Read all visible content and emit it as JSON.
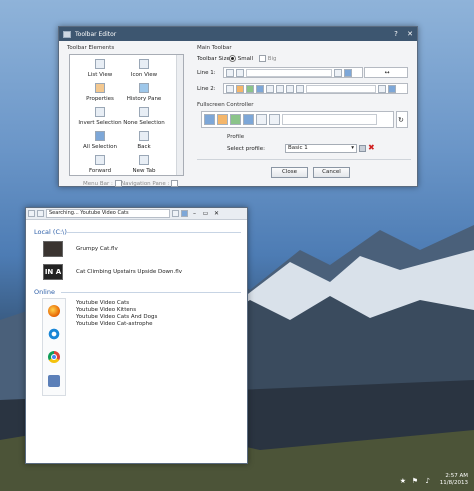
{
  "toolbar_editor": {
    "title": "Toolbar Editor",
    "help": "?",
    "close": "✕",
    "toolbar_elements_label": "Toolbar Elements",
    "tiles": [
      {
        "label": "List View"
      },
      {
        "label": "Icon View"
      },
      {
        "label": "Properties"
      },
      {
        "label": "History Pane"
      },
      {
        "label": "Invert Selection"
      },
      {
        "label": "None Selection"
      },
      {
        "label": "All Selection"
      },
      {
        "label": "Back"
      },
      {
        "label": "Forward"
      },
      {
        "label": "New Tab"
      }
    ],
    "menu_bar_label": "Menu Bar :",
    "navigation_pane_label": "Navigation Pane :",
    "main_toolbar_label": "Main Toolbar",
    "toolbar_size_label": "Toolbar Size :",
    "small_label": "Small",
    "big_label": "Big",
    "line1_label": "Line 1:",
    "line2_label": "Line 2:",
    "fullscreen_label": "Fullscreen Controller",
    "profile_label": "Profile",
    "select_profile_label": "Select profile:",
    "profile_value": "Basic 1",
    "close_button": "Close",
    "cancel_button": "Cancel"
  },
  "search_window": {
    "title": "Searching... Youtube Video Cats",
    "local_header": "Local (C:\\)",
    "local_results": [
      "Grumpy Cat.flv",
      "Cat Climbing Upstairs Upside Down.flv"
    ],
    "online_header": "Online",
    "online_results": [
      "Youtube Video Cats",
      "Youtube Video Kittens",
      "Youtube Video Cats And Dogs",
      "Youtube Video Cat-astrophe"
    ],
    "thumb_text": "IN A"
  },
  "tray": {
    "time": "2:57 AM",
    "date": "11/8/2013"
  },
  "colors": {
    "titlebar": "#3d5670",
    "section_blue": "#2d5fa8"
  }
}
